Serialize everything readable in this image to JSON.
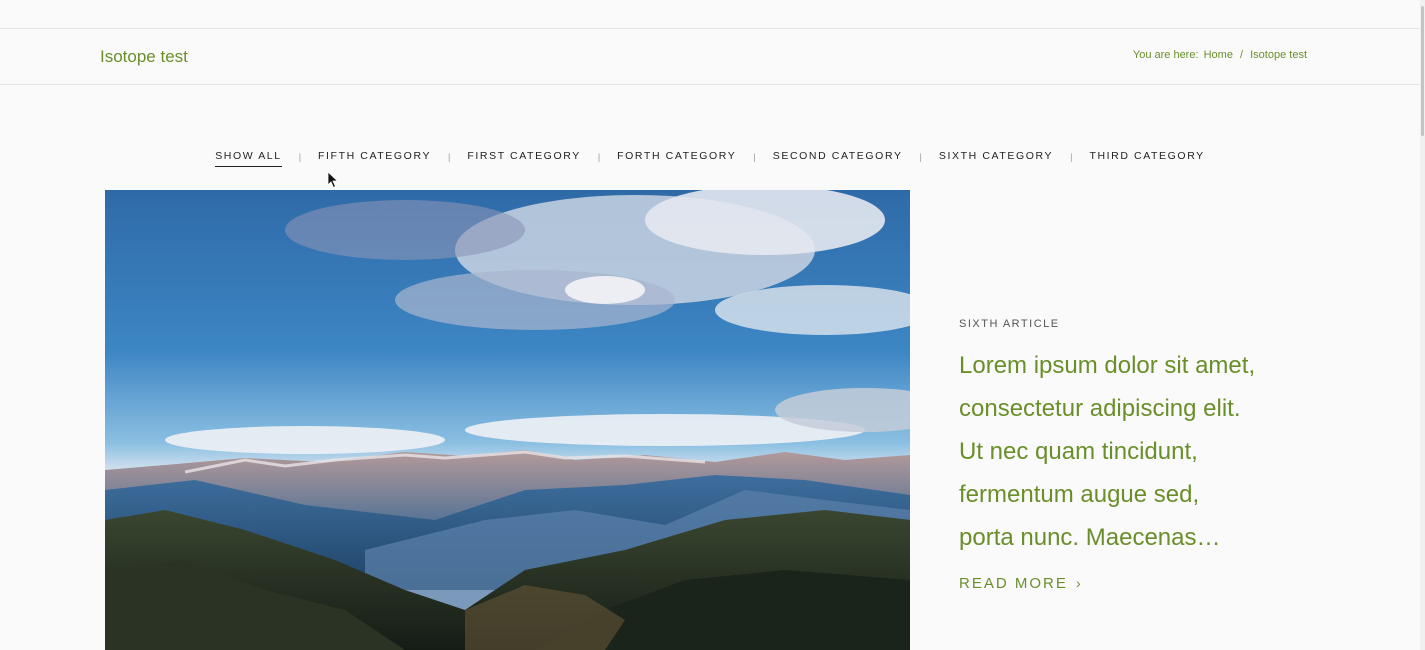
{
  "header": {
    "site_title": "Isotope test",
    "breadcrumb": {
      "lead": "You are here:",
      "items": [
        "Home",
        "Isotope test"
      ],
      "separator": "/"
    }
  },
  "filters": {
    "items": [
      "SHOW ALL",
      "FIFTH CATEGORY",
      "FIRST CATEGORY",
      "FORTH CATEGORY",
      "SECOND CATEGORY",
      "SIXTH CATEGORY",
      "THIRD CATEGORY"
    ],
    "active": "SHOW ALL",
    "divider": "|"
  },
  "article": {
    "eyebrow": "SIXTH ARTICLE",
    "excerpt": "Lorem ipsum dolor sit amet, consectetur adipiscing elit. Ut nec quam tincidunt, fermentum augue sed, porta nunc. Maecenas…",
    "read_more": "READ MORE",
    "read_more_icon": "chevron-right-icon"
  },
  "colors": {
    "accent": "#6a8f2a",
    "background": "#fafafa",
    "text_dark": "#222222"
  }
}
